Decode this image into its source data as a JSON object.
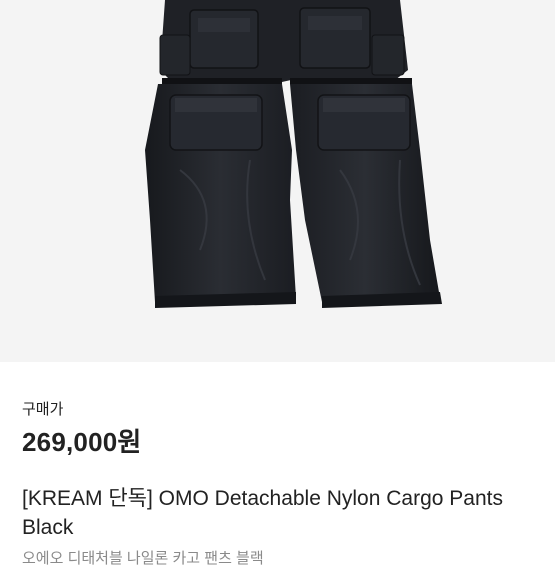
{
  "product": {
    "image_alt": "OMO Detachable Nylon Cargo Pants Black",
    "price_label": "구매가",
    "price": "269,000원",
    "title": "[KREAM 단독] OMO Detachable Nylon Cargo Pants Black",
    "subtitle": "오에오 디태처블 나일론 카고 팬츠 블랙"
  },
  "colors": {
    "image_background": "#f4f4f4",
    "garment": "#202227",
    "text_primary": "#222222",
    "text_secondary": "#8a8a8a"
  }
}
